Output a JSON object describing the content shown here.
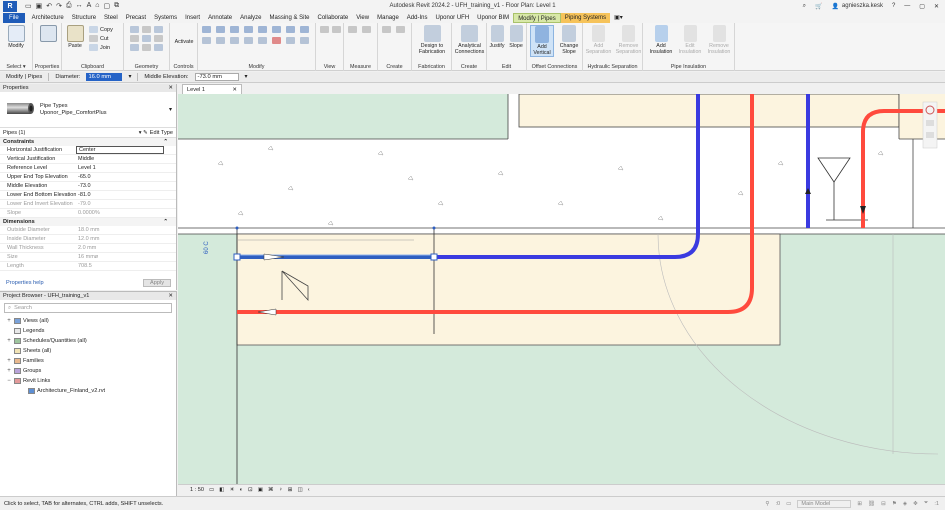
{
  "titlebar": {
    "logo": "R",
    "title": "Autodesk Revit 2024.2 - UFH_training_v1 - Floor Plan: Level 1",
    "user": "agnieszka.kesk"
  },
  "tabs": [
    "File",
    "Architecture",
    "Structure",
    "Steel",
    "Precast",
    "Systems",
    "Insert",
    "Annotate",
    "Analyze",
    "Massing & Site",
    "Collaborate",
    "View",
    "Manage",
    "Add-Ins",
    "Uponor UFH",
    "Uponor BIM",
    "Modify | Pipes",
    "Piping Systems"
  ],
  "ribbon": {
    "modify": "Modify",
    "paste": "Paste",
    "copy": "Copy",
    "cut": "Cut",
    "join": "Join",
    "activate": "Activate",
    "design_to_fabrication": "Design to Fabrication",
    "analytical_connections": "Analytical Connections",
    "justify": "Justify",
    "slope": "Slope",
    "add_vertical": "Add Vertical",
    "change_slope": "Change Slope",
    "add_separation": "Add Separation",
    "remove_separation": "Remove Separation",
    "add_insulation": "Add Insulation",
    "edit_insulation": "Edit Insulation",
    "remove_insulation": "Remove Insulation",
    "panels": {
      "select": "Select",
      "properties": "Properties",
      "clipboard": "Clipboard",
      "geometry": "Geometry",
      "controls": "Controls",
      "modify": "Modify",
      "view": "View",
      "measure": "Measure",
      "create": "Create",
      "fabrication": "Fabrication",
      "create2": "Create",
      "edit": "Edit",
      "offset": "Offset Connections",
      "hydraulic": "Hydraulic Separation",
      "insulation": "Pipe Insulation"
    }
  },
  "optbar": {
    "context": "Modify | Pipes",
    "diameter_label": "Diameter:",
    "diameter_value": "16.0 mm",
    "elevation_label": "Middle Elevation:",
    "elevation_value": "-73.0 mm"
  },
  "properties": {
    "title": "Properties",
    "type_family": "Pipe Types",
    "type_name": "Uponor_Pipe_ComfortPlus",
    "instance": "Pipes (1)",
    "edit_type": "Edit Type",
    "sections": {
      "constraints": "Constraints",
      "dimensions": "Dimensions"
    },
    "constraints": [
      {
        "k": "Horizontal Justification",
        "v": "Center",
        "box": true
      },
      {
        "k": "Vertical Justification",
        "v": "Middle"
      },
      {
        "k": "Reference Level",
        "v": "Level 1"
      },
      {
        "k": "Upper End Top Elevation",
        "v": "-65.0"
      },
      {
        "k": "Middle Elevation",
        "v": "-73.0"
      },
      {
        "k": "Lower End Bottom Elevation",
        "v": "-81.0"
      },
      {
        "k": "Lower End Invert Elevation",
        "v": "-79.0",
        "dis": true
      },
      {
        "k": "Slope",
        "v": "0.0000%",
        "dis": true
      }
    ],
    "dimensions": [
      {
        "k": "Outside Diameter",
        "v": "18.0 mm",
        "dis": true
      },
      {
        "k": "Inside Diameter",
        "v": "12.0 mm",
        "dis": true
      },
      {
        "k": "Wall Thickness",
        "v": "2.0 mm",
        "dis": true
      },
      {
        "k": "Size",
        "v": "16 mmø",
        "dis": true
      },
      {
        "k": "Length",
        "v": "708.5",
        "dis": true
      }
    ],
    "help": "Properties help",
    "apply": "Apply"
  },
  "browser": {
    "title": "Project Browser - UFH_training_v1",
    "search_placeholder": "Search",
    "items": [
      {
        "label": "Views (all)",
        "toggle": "+",
        "icon": "views"
      },
      {
        "label": "Legends",
        "toggle": "",
        "icon": "legend"
      },
      {
        "label": "Schedules/Quantities (all)",
        "toggle": "+",
        "icon": "schedule"
      },
      {
        "label": "Sheets (all)",
        "toggle": "",
        "icon": "sheet"
      },
      {
        "label": "Families",
        "toggle": "+",
        "icon": "family"
      },
      {
        "label": "Groups",
        "toggle": "+",
        "icon": "group"
      },
      {
        "label": "Revit Links",
        "toggle": "−",
        "icon": "link"
      },
      {
        "label": "Architecture_Finland_v2.rvt",
        "toggle": "",
        "icon": "rvt",
        "indent": true
      }
    ]
  },
  "view": {
    "tab": "Level 1",
    "scale": "1 : 50",
    "tag": "60 C"
  },
  "status": {
    "message": "Click to select, TAB for alternates, CTRL adds, SHIFT unselects.",
    "model": "Main Model",
    "filter_count": ":1"
  },
  "colors": {
    "revit_blue": "#1e5bb8",
    "modify_tab": "#d8e8a8",
    "piping_tab": "#f6c35a",
    "pipe_red": "#ff4a3d",
    "pipe_blue": "#3a3ae0",
    "floor_green": "#d4eadb",
    "room_beige": "#fcf4df"
  }
}
